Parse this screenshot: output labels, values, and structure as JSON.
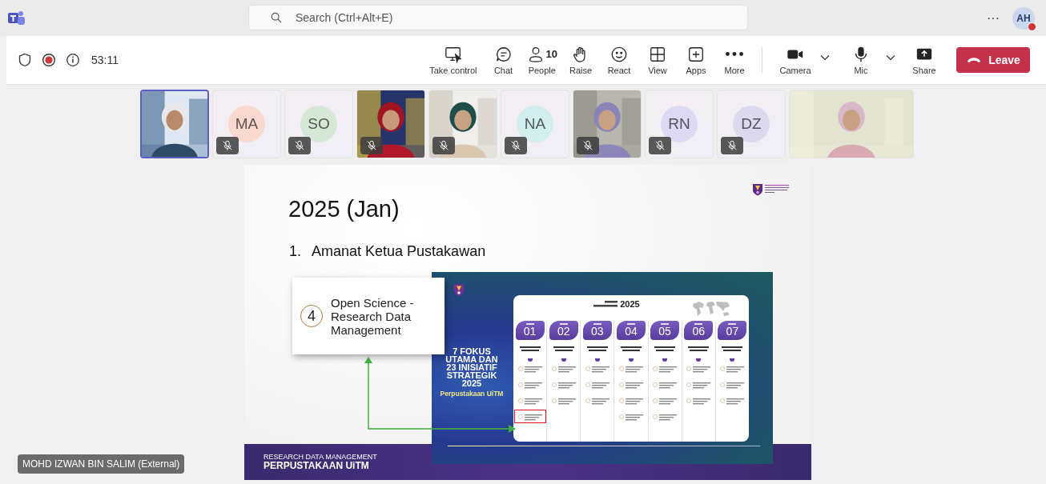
{
  "app": {
    "search_placeholder": "Search (Ctrl+Alt+E)",
    "more": "···",
    "avatar": "AH",
    "avatar_busy": true
  },
  "meeting_bar": {
    "duration": "53:11",
    "recording": true,
    "actions": [
      {
        "label": "Take control"
      },
      {
        "label": "Chat"
      },
      {
        "label": "People",
        "count": "10"
      },
      {
        "label": "Raise"
      },
      {
        "label": "React"
      },
      {
        "label": "View"
      },
      {
        "label": "Apps"
      },
      {
        "label": "More"
      }
    ],
    "devices": [
      {
        "label": "Camera"
      },
      {
        "label": "Mic"
      }
    ],
    "share": "Share",
    "leave": "Leave"
  },
  "participants": [
    {
      "kind": "video",
      "selected": true,
      "muted": false
    },
    {
      "kind": "initials",
      "initials": "MA",
      "color": "#f9d8cf",
      "selected": false,
      "muted": true
    },
    {
      "kind": "initials",
      "initials": "SO",
      "color": "#d5e8d6",
      "selected": false,
      "muted": true
    },
    {
      "kind": "video",
      "selected": false,
      "muted": true
    },
    {
      "kind": "video",
      "selected": false,
      "muted": true
    },
    {
      "kind": "initials",
      "initials": "NA",
      "color": "#d3eeee",
      "selected": false,
      "muted": true
    },
    {
      "kind": "video",
      "selected": false,
      "muted": true
    },
    {
      "kind": "initials",
      "initials": "RN",
      "color": "#dcdaf2",
      "selected": false,
      "muted": true
    },
    {
      "kind": "initials",
      "initials": "DZ",
      "color": "#dcd9ef",
      "selected": false,
      "muted": true
    },
    {
      "kind": "video",
      "wide": true,
      "selected": false,
      "muted": false
    }
  ],
  "slide": {
    "title": "2025 (Jan)",
    "list": [
      {
        "number": "1.",
        "text": "Amanat Ketua Pustakawan"
      }
    ],
    "callout": {
      "number": "4",
      "text": "Open Science - Research Data Management"
    },
    "infographic": {
      "heading_year": "2025",
      "headline": "7 FOKUS UTAMA DAN 23 INISIATIF STRATEGIK 2025",
      "subline": "Perpustakaan UiTM",
      "focus": [
        {
          "number": "01",
          "highlighted": true
        },
        {
          "number": "02",
          "highlighted": false
        },
        {
          "number": "03",
          "highlighted": false
        },
        {
          "number": "04",
          "highlighted": false
        },
        {
          "number": "05",
          "highlighted": false
        },
        {
          "number": "06",
          "highlighted": false
        },
        {
          "number": "07",
          "highlighted": false
        }
      ]
    },
    "footer": {
      "line1": "RESEARCH DATA MANAGEMENT",
      "line2": "PERPUSTAKAAN UiTM"
    }
  },
  "presenter": "MOHD IZWAN BIN SALIM (External)"
}
